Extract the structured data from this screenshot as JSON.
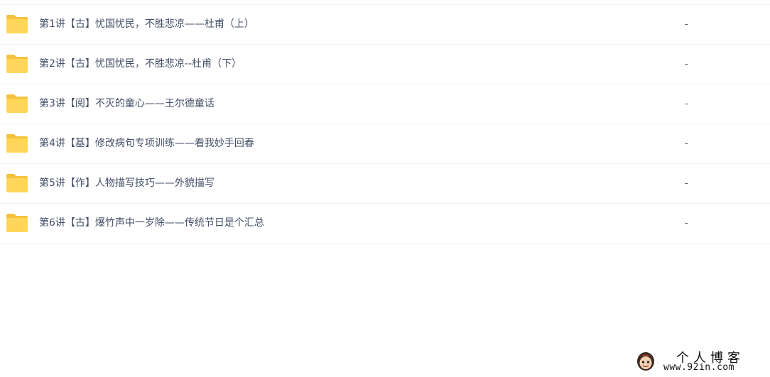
{
  "files": [
    {
      "name": "第1讲【古】忧国忧民，不胜悲凉——杜甫（上）",
      "size": "-",
      "icon": "folder-icon"
    },
    {
      "name": "第2讲【古】忧国忧民，不胜悲凉--杜甫（下）",
      "size": "-",
      "icon": "folder-icon"
    },
    {
      "name": "第3讲【阅】不灭的童心——王尔德童话",
      "size": "-",
      "icon": "folder-icon"
    },
    {
      "name": "第4讲【基】修改病句专项训练——看我妙手回春",
      "size": "-",
      "icon": "folder-icon"
    },
    {
      "name": "第5讲【作】人物描写技巧——外貌描写",
      "size": "-",
      "icon": "folder-icon"
    },
    {
      "name": "第6讲【古】爆竹声中一岁除——传统节日是个汇总",
      "size": "-",
      "icon": "folder-icon"
    }
  ],
  "watermark": {
    "title": "个人博客",
    "url": "www.92in.com"
  },
  "colors": {
    "folder": "#ffd659",
    "folder_tab": "#f5c23e",
    "text": "#424e67",
    "divider": "#f1f2f4"
  }
}
